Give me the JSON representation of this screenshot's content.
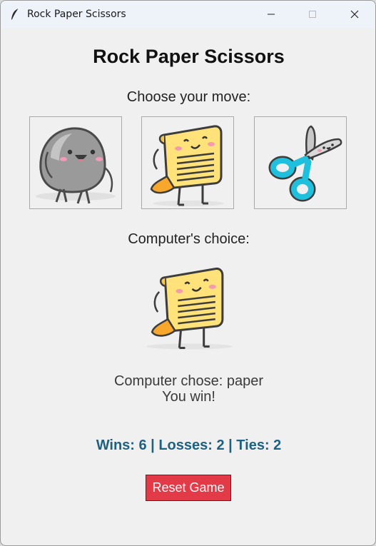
{
  "window": {
    "title": "Rock Paper Scissors",
    "icon": "feather-icon"
  },
  "game": {
    "heading": "Rock Paper Scissors",
    "prompt": "Choose your move:",
    "choices": [
      {
        "id": "rock",
        "icon": "rock-character-icon"
      },
      {
        "id": "paper",
        "icon": "paper-character-icon"
      },
      {
        "id": "scissors",
        "icon": "scissors-character-icon"
      }
    ],
    "computer_label": "Computer's choice:",
    "computer_icon": "paper-character-icon",
    "result_chose": "Computer chose: paper",
    "result_outcome": "You win!",
    "score": "Wins: 6 | Losses: 2 | Ties: 2",
    "reset_label": "Reset Game"
  },
  "colors": {
    "background": "#f0f0f0",
    "score_text": "#1e6180",
    "reset_button": "#e33a47",
    "paper_yellow": "#ffe27a",
    "scissors_blue": "#1ec0dd"
  }
}
